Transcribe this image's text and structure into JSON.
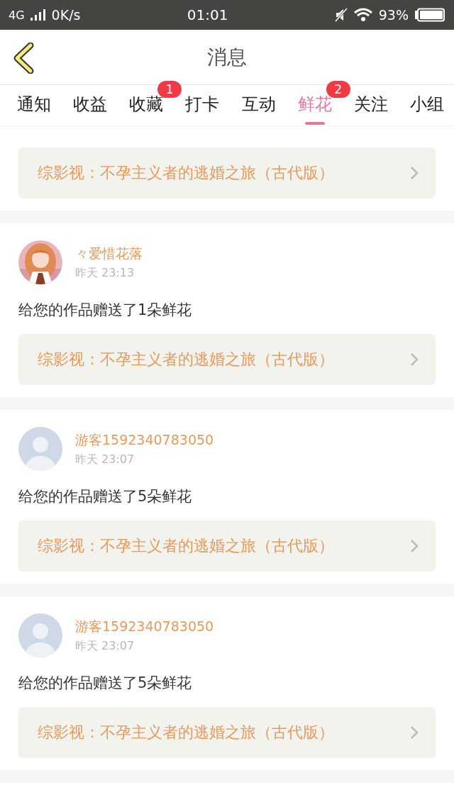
{
  "status_bar": {
    "network": "4G",
    "speed": "0K/s",
    "time": "01:01",
    "battery": "93%"
  },
  "header": {
    "title": "消息"
  },
  "tabs": [
    {
      "label": "通知",
      "selected": false
    },
    {
      "label": "收益",
      "selected": false
    },
    {
      "label": "收藏",
      "selected": false,
      "badge": "1"
    },
    {
      "label": "打卡",
      "selected": false
    },
    {
      "label": "互动",
      "selected": false
    },
    {
      "label": "鲜花",
      "selected": true,
      "badge": "2"
    },
    {
      "label": "关注",
      "selected": false
    },
    {
      "label": "小组",
      "selected": false
    }
  ],
  "partial_card": {
    "work": "综影视：不孕主义者的逃婚之旅（古代版）"
  },
  "messages": [
    {
      "kind": "picture",
      "user": "々爱惜花落",
      "time": "昨天 23:13",
      "text": "给您的作品赠送了1朵鲜花",
      "work": "综影视：不孕主义者的逃婚之旅（古代版）"
    },
    {
      "kind": "default",
      "user": "游客1592340783050",
      "time": "昨天 23:07",
      "text": "给您的作品赠送了5朵鲜花",
      "work": "综影视：不孕主义者的逃婚之旅（古代版）"
    },
    {
      "kind": "default",
      "user": "游客1592340783050",
      "time": "昨天 23:07",
      "text": "给您的作品赠送了5朵鲜花",
      "work": "综影视：不孕主义者的逃婚之旅（古代版）"
    }
  ]
}
